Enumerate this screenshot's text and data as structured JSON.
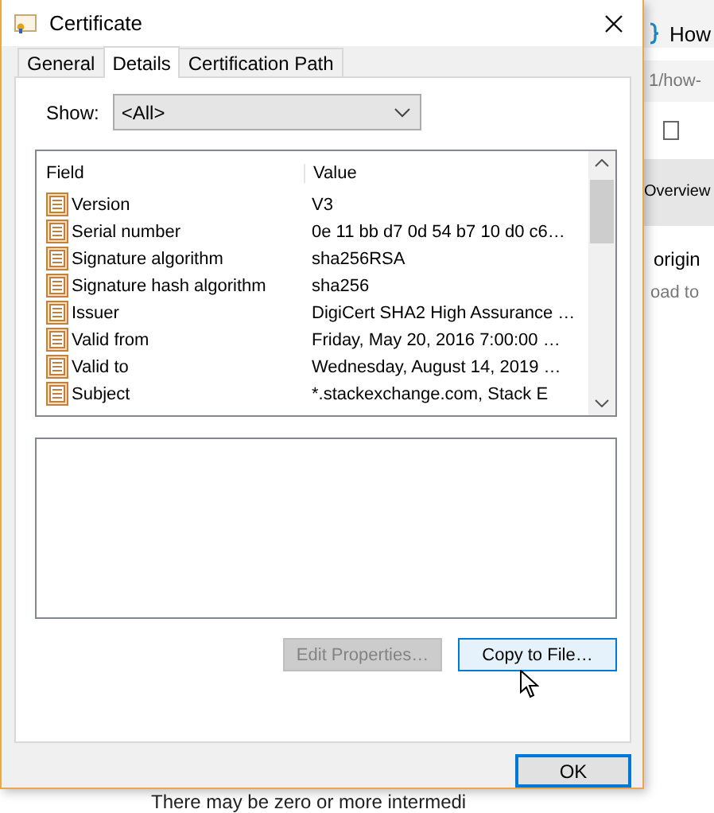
{
  "window": {
    "title": "Certificate"
  },
  "tabs": [
    {
      "label": "General",
      "selected": false
    },
    {
      "label": "Details",
      "selected": true
    },
    {
      "label": "Certification Path",
      "selected": false
    }
  ],
  "show": {
    "label": "Show:",
    "value": "<All>"
  },
  "table": {
    "columns": [
      "Field",
      "Value"
    ],
    "rows": [
      {
        "field": "Version",
        "value": "V3"
      },
      {
        "field": "Serial number",
        "value": "0e 11 bb d7 0d 54 b7 10 d0 c6…"
      },
      {
        "field": "Signature algorithm",
        "value": "sha256RSA"
      },
      {
        "field": "Signature hash algorithm",
        "value": "sha256"
      },
      {
        "field": "Issuer",
        "value": "DigiCert SHA2 High Assurance …"
      },
      {
        "field": "Valid from",
        "value": "Friday, May 20, 2016 7:00:00 …"
      },
      {
        "field": "Valid to",
        "value": "Wednesday, August 14, 2019 …"
      },
      {
        "field": "Subject",
        "value": "*.stackexchange.com, Stack E"
      }
    ]
  },
  "buttons": [
    {
      "label": "Edit Properties…",
      "disabled": true
    },
    {
      "label": "Copy to File…",
      "disabled": false
    }
  ],
  "ok_button": "OK",
  "background": {
    "tab_title": "How",
    "address": "1/how-",
    "section": "Overview",
    "texts": [
      "origin",
      "oad to"
    ],
    "footer": "There may be zero or more intermedi"
  }
}
